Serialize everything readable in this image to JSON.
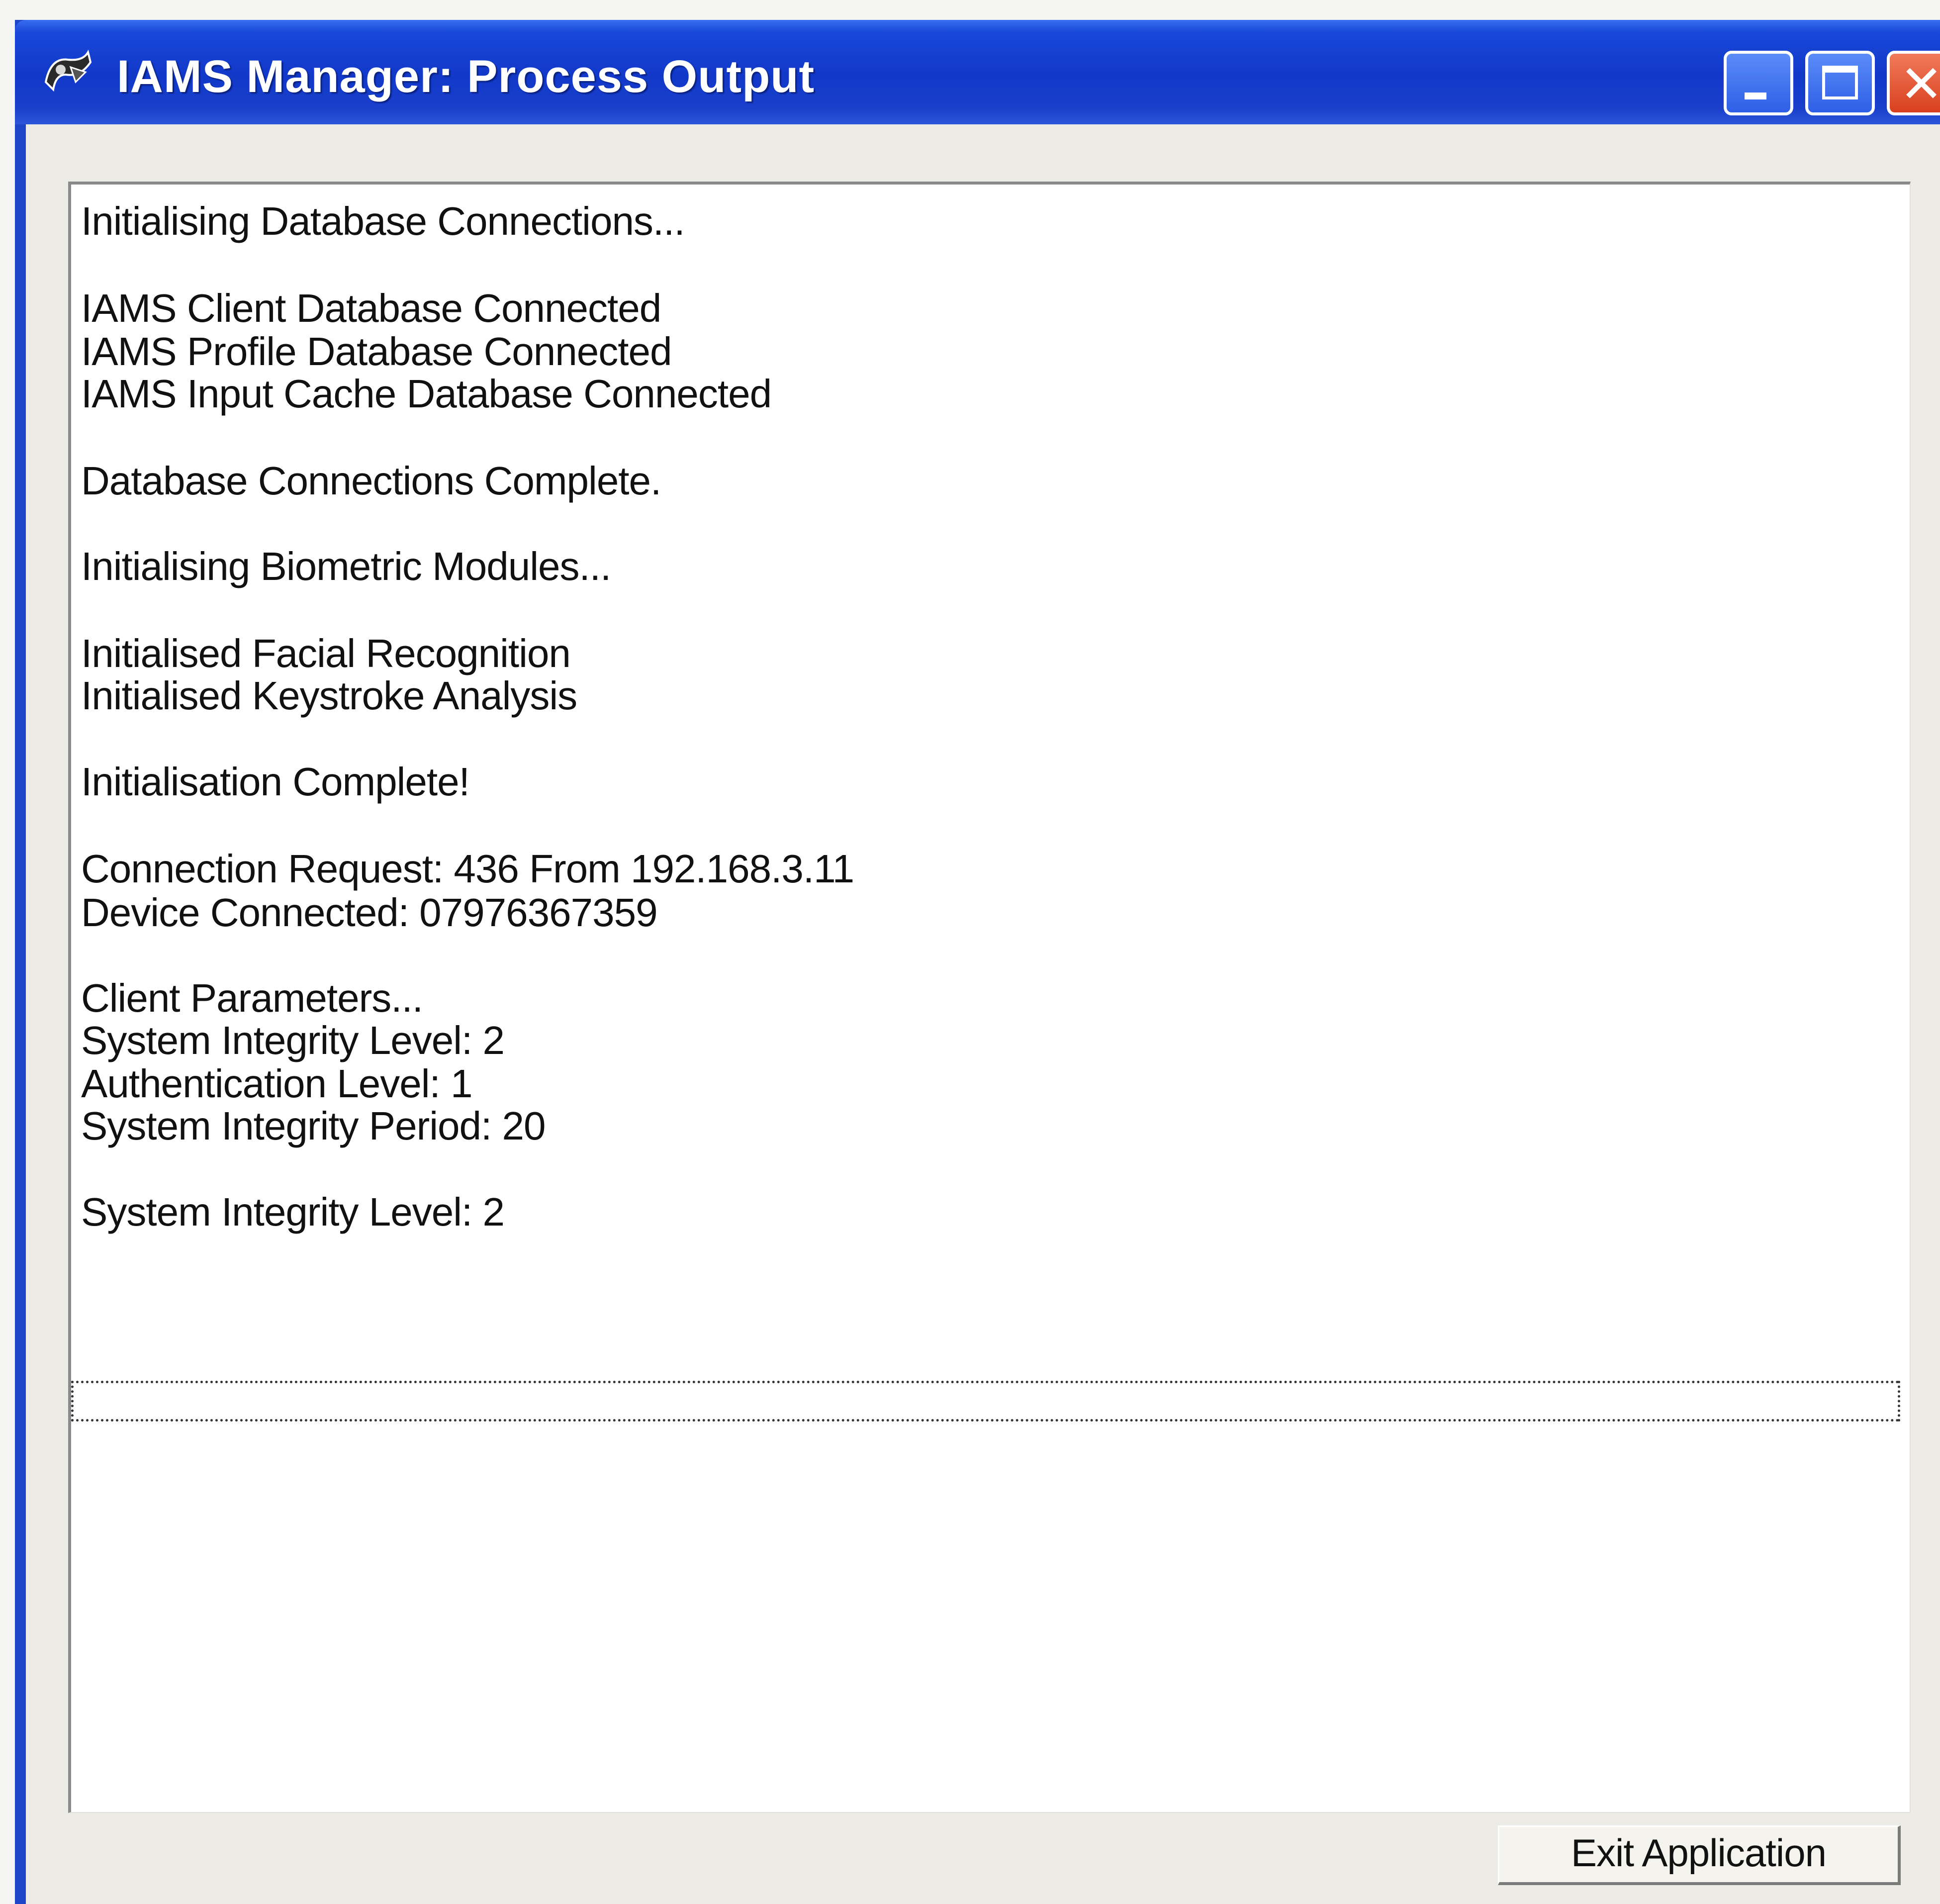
{
  "window": {
    "title": "IAMS Manager: Process Output",
    "icon": "app-icon",
    "controls": {
      "minimize_icon": "minimize-icon",
      "maximize_icon": "maximize-icon",
      "close_icon": "close-icon",
      "close_glyph": "✕"
    },
    "accent_color": "#1d45c8"
  },
  "output": {
    "lines": [
      "Initialising Database Connections...",
      "IAMS Client Database Connected",
      "IAMS Profile Database Connected",
      "IAMS Input Cache Database Connected",
      "Database Connections Complete.",
      "Initialising Biometric Modules...",
      "Initialised Facial Recognition",
      "Initialised Keystroke Analysis",
      "Initialisation Complete!",
      "Connection Request: 436 From 192.168.3.11",
      "Device Connected: 07976367359",
      "Client Parameters...",
      "System Integrity Level: 2",
      "Authentication Level: 1",
      "System Integrity Period: 20",
      "System Integrity Level: 2"
    ]
  },
  "buttons": {
    "exit_label": "Exit Application"
  }
}
